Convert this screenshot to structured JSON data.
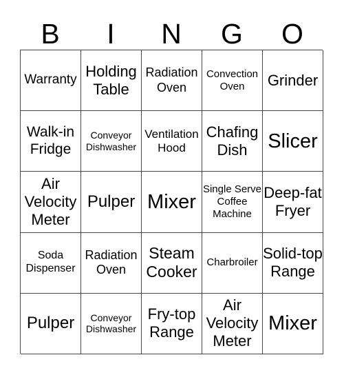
{
  "header": [
    "B",
    "I",
    "N",
    "G",
    "O"
  ],
  "cells": [
    [
      "Warranty",
      "Holding Table",
      "Radiation Oven",
      "Convection Oven",
      "Grinder"
    ],
    [
      "Walk-in Fridge",
      "Conveyor Dishwasher",
      "Ventilation Hood",
      "Chafing Dish",
      "Slicer"
    ],
    [
      "Air Velocity Meter",
      "Pulper",
      "Mixer",
      "Single Serve Coffee Machine",
      "Deep-fat Fryer"
    ],
    [
      "Soda Dispenser",
      "Radiation Oven",
      "Steam Cooker",
      "Charbroiler",
      "Solid-top Range"
    ],
    [
      "Pulper",
      "Conveyor Dishwasher",
      "Fry-top Range",
      "Air Velocity Meter",
      "Mixer"
    ]
  ]
}
